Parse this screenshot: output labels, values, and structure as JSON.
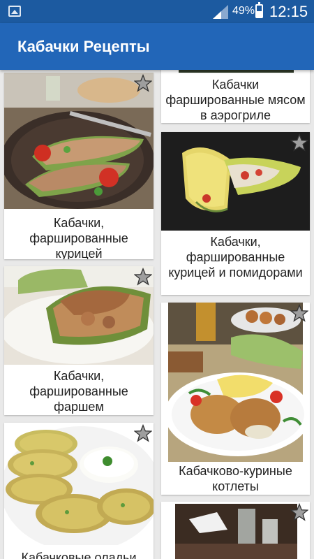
{
  "status": {
    "battery_percent": "49%",
    "time": "12:15"
  },
  "appbar": {
    "title": "Кабачки Рецепты"
  },
  "recipes": [
    {
      "title": "Кабачки фаршированные мясом в аэрогриле"
    },
    {
      "title": "Кабачки, фаршированные курицей"
    },
    {
      "title": "Кабачки, фаршированные курицей и помидорами"
    },
    {
      "title": "Кабачки, фаршированные фаршем"
    },
    {
      "title": "Кабачково-куриные котлеты"
    },
    {
      "title": "Кабачковые оладьи"
    },
    {
      "title": ""
    }
  ],
  "colors": {
    "status_bar": "#1c5aa0",
    "app_bar": "#2266b8",
    "background": "#e9e9e9"
  }
}
